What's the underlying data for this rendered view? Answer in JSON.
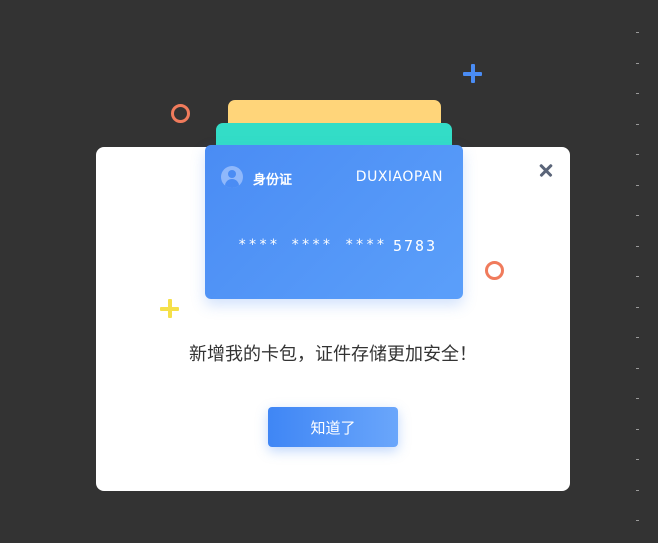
{
  "card": {
    "type_label": "身份证",
    "holder_name": "DUXIAOPAN",
    "number_groups": [
      "****",
      "****",
      "****",
      "5783"
    ]
  },
  "dialog": {
    "message": "新增我的卡包，证件存储更加安全！",
    "confirm_label": "知道了"
  },
  "icons": {
    "close": "close-icon",
    "avatar": "user-avatar-icon"
  },
  "colors": {
    "background": "#333333",
    "accent_blue": "#4a8cf4",
    "card_yellow": "#ffd57a",
    "card_teal": "#33ddc7",
    "ring_orange": "#f07b5c",
    "plus_yellow": "#f5e04a"
  }
}
